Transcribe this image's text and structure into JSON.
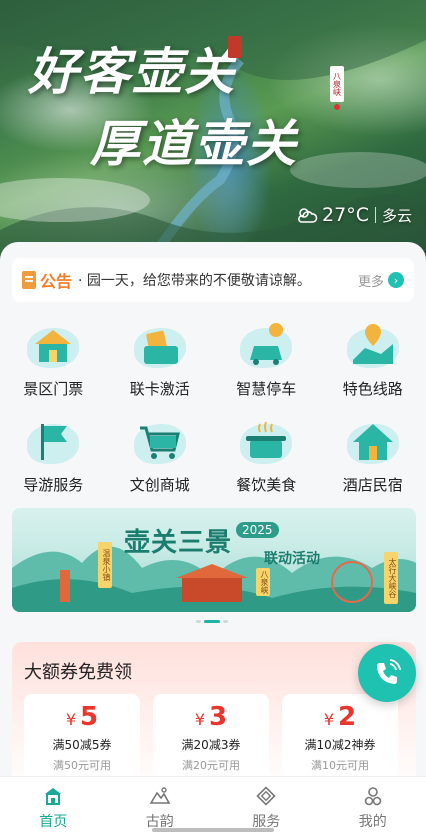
{
  "hero": {
    "title_line1": "好客壶关",
    "title_line2": "厚道壶关",
    "tag": "八泉峡",
    "weather": {
      "icon": "partly-cloudy-icon",
      "temp": "27°C",
      "condition": "多云"
    }
  },
  "notice": {
    "label": "公告",
    "text": "· 园一天，给您带来的不便敬请谅解。",
    "more": "更多"
  },
  "services": [
    {
      "label": "景区门票",
      "icon": "scenic-gate-icon"
    },
    {
      "label": "联卡激活",
      "icon": "card-activate-icon"
    },
    {
      "label": "智慧停车",
      "icon": "parking-car-icon"
    },
    {
      "label": "特色线路",
      "icon": "route-map-icon"
    },
    {
      "label": "导游服务",
      "icon": "guide-flag-icon"
    },
    {
      "label": "文创商城",
      "icon": "shopping-cart-icon"
    },
    {
      "label": "餐饮美食",
      "icon": "cooking-pot-icon"
    },
    {
      "label": "酒店民宿",
      "icon": "hotel-house-icon"
    }
  ],
  "banner": {
    "title": "壶关三景",
    "year": "2025",
    "subtitle": "联动活动",
    "left_tag": "温泉小镇",
    "mid_tag": "八泉峡",
    "right_tag": "太行大峡谷"
  },
  "carousel": {
    "current": 2,
    "total": 3
  },
  "coupons": {
    "title": "大额券免费领",
    "items": [
      {
        "currency": "¥",
        "amount": "5",
        "name": "满50减5券",
        "note": "满50元可用"
      },
      {
        "currency": "¥",
        "amount": "3",
        "name": "满20减3券",
        "note": "满20元可用"
      },
      {
        "currency": "¥",
        "amount": "2",
        "name": "满10减2神券",
        "note": "满10元可用"
      }
    ]
  },
  "tabs": [
    {
      "label": "首页",
      "icon": "home-pavilion-icon",
      "active": true
    },
    {
      "label": "古韵",
      "icon": "mountain-icon",
      "active": false
    },
    {
      "label": "服务",
      "icon": "service-knot-icon",
      "active": false
    },
    {
      "label": "我的",
      "icon": "user-profile-icon",
      "active": false
    }
  ],
  "colors": {
    "accent": "#1fc2b0",
    "notice": "#f07d2a",
    "coupon": "#e9352b"
  }
}
